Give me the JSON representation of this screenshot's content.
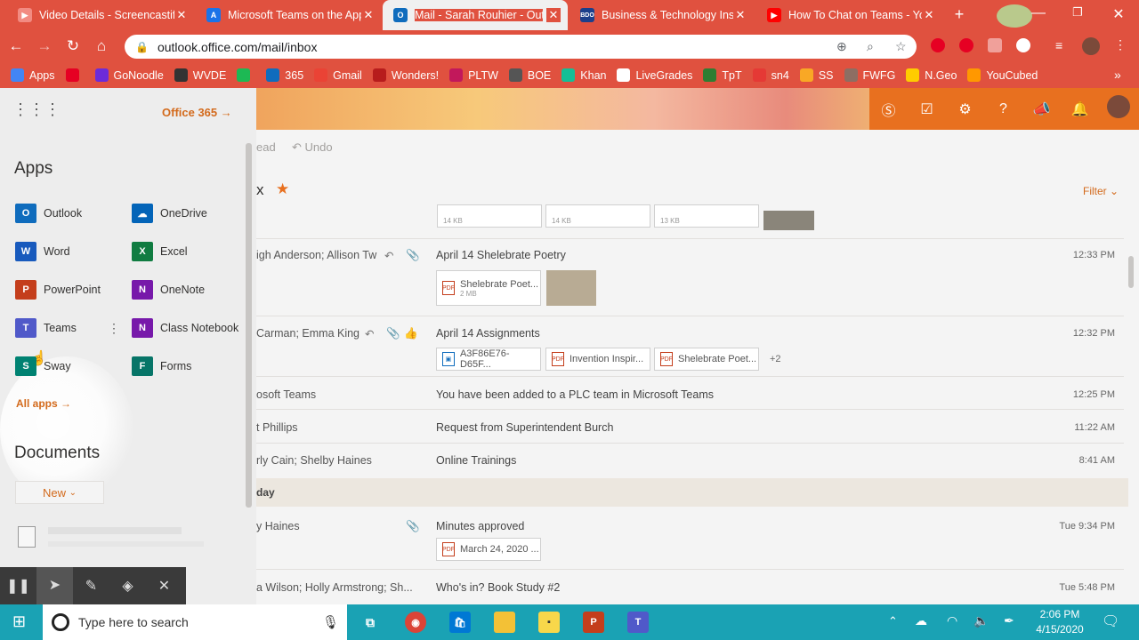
{
  "browser": {
    "tabs": [
      {
        "title": "Video Details - Screencastify",
        "icon": "screencastify-icon",
        "color": "#e0513f"
      },
      {
        "title": "Microsoft Teams on the App Store",
        "icon": "appstore-icon",
        "color": "#1a73e8"
      },
      {
        "title": "Mail - Sarah Rouhier - Outlook",
        "icon": "outlook-icon",
        "color": "#0f6cbd"
      },
      {
        "title": "Business & Technology Insights",
        "icon": "bdo-icon",
        "color": "#1b3f8b"
      },
      {
        "title": "How To Chat on Teams - YouTube",
        "icon": "youtube-icon",
        "color": "#ff0000"
      }
    ],
    "new_tab": "+",
    "url": "outlook.office.com/mail/inbox",
    "bookmarks": [
      {
        "label": "Apps",
        "color": "#4285f4"
      },
      {
        "label": "",
        "color": "#e60023"
      },
      {
        "label": "GoNoodle",
        "color": "#6c2bd9"
      },
      {
        "label": "WVDE",
        "color": "#333333"
      },
      {
        "label": "",
        "color": "#1db954"
      },
      {
        "label": "365",
        "color": "#0f6cbd"
      },
      {
        "label": "Gmail",
        "color": "#ea4335"
      },
      {
        "label": "Wonders!",
        "color": "#b71c1c"
      },
      {
        "label": "PLTW",
        "color": "#c2185b"
      },
      {
        "label": "BOE",
        "color": "#555555"
      },
      {
        "label": "Khan",
        "color": "#14bf96"
      },
      {
        "label": "LiveGrades",
        "color": "#ffffff"
      },
      {
        "label": "TpT",
        "color": "#2e7d32"
      },
      {
        "label": "sn4",
        "color": "#e53935"
      },
      {
        "label": "SS",
        "color": "#f9a825"
      },
      {
        "label": "FWFG",
        "color": "#8d6e63"
      },
      {
        "label": "N.Geo",
        "color": "#ffcc00"
      },
      {
        "label": "YouCubed",
        "color": "#ff9800"
      }
    ]
  },
  "launcher": {
    "office_link": "Office 365",
    "apps_heading": "Apps",
    "apps": [
      {
        "label": "Outlook",
        "letter": "O",
        "color": "#0f6cbd"
      },
      {
        "label": "OneDrive",
        "letter": "☁",
        "color": "#0364b8"
      },
      {
        "label": "Word",
        "letter": "W",
        "color": "#185abd"
      },
      {
        "label": "Excel",
        "letter": "X",
        "color": "#107c41"
      },
      {
        "label": "PowerPoint",
        "letter": "P",
        "color": "#c43e1c"
      },
      {
        "label": "OneNote",
        "letter": "N",
        "color": "#7719aa"
      },
      {
        "label": "Teams",
        "letter": "T",
        "color": "#5059c9"
      },
      {
        "label": "Class Notebook",
        "letter": "N",
        "color": "#7719aa"
      },
      {
        "label": "Sway",
        "letter": "S",
        "color": "#008272"
      },
      {
        "label": "Forms",
        "letter": "F",
        "color": "#077568"
      }
    ],
    "all_apps": "All apps",
    "documents_heading": "Documents",
    "new_button": "New"
  },
  "mail": {
    "cmd_read": "ead",
    "cmd_undo": "Undo",
    "folder_fragment": "x",
    "filter": "Filter",
    "messages": [
      {
        "sender": "igh Anderson; Allison Tw",
        "subject": "April 14 Shelebrate Poetry",
        "time": "12:33 PM",
        "attachments": [
          {
            "name": "Shelebrate Poet...",
            "size": "2 MB"
          }
        ]
      },
      {
        "sender": "Carman; Emma King",
        "subject": "April 14 Assignments",
        "time": "12:32 PM",
        "attachments": [
          {
            "name": "A3F86E76-D65F..."
          },
          {
            "name": "Invention Inspir..."
          },
          {
            "name": "Shelebrate Poet..."
          }
        ],
        "more": "+2"
      },
      {
        "sender": "osoft Teams",
        "subject": "You have been added to a PLC team in Microsoft Teams",
        "time": "12:25 PM"
      },
      {
        "sender": "t Phillips",
        "subject": "Request from Superintendent Burch",
        "time": "11:22 AM"
      },
      {
        "sender": "rly Cain; Shelby Haines",
        "subject": "Online Trainings",
        "time": "8:41 AM"
      },
      {
        "sender": "y Haines",
        "subject": "Minutes approved",
        "time": "Tue 9:34 PM",
        "attachments": [
          {
            "name": "March 24, 2020 ..."
          }
        ]
      },
      {
        "sender": "a Wilson; Holly Armstrong; Sh...",
        "subject": "Who's in? Book Study #2",
        "time": "Tue 5:48 PM"
      }
    ],
    "group_header": "day",
    "top_att_sizes": [
      "14 KB",
      "14 KB",
      "13 KB"
    ]
  },
  "taskbar": {
    "search_placeholder": "Type here to search",
    "time": "2:06 PM",
    "date": "4/15/2020"
  }
}
